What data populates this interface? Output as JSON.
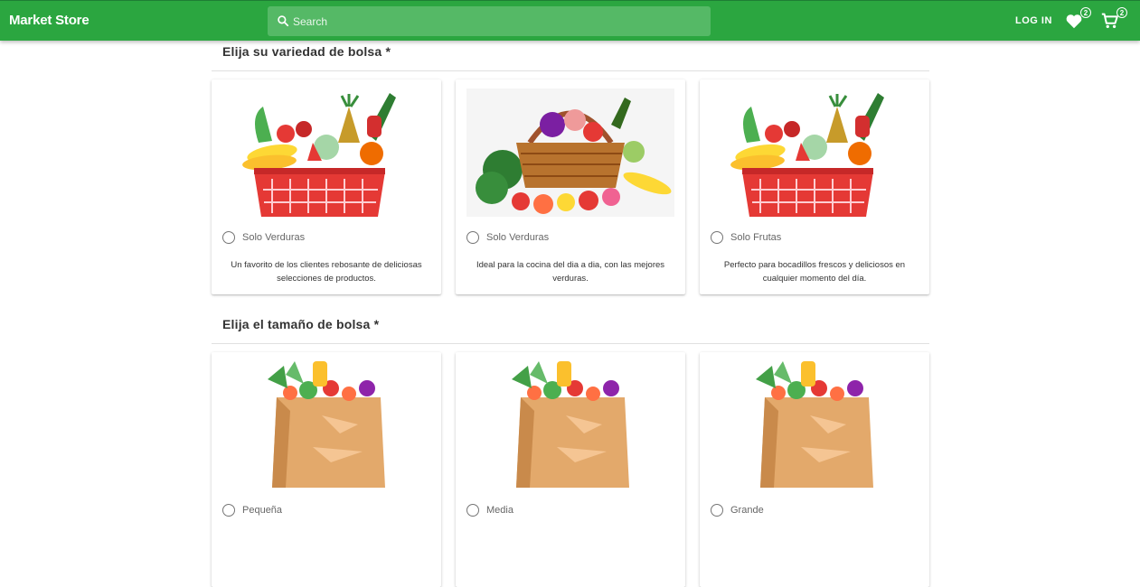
{
  "header": {
    "brand": "Market Store",
    "search_placeholder": "Search",
    "login_label": "LOG IN",
    "wishlist_count": "2",
    "cart_count": "2"
  },
  "colors": {
    "primary": "#2ba640",
    "search_bg": "#55b966"
  },
  "variety_section": {
    "title": "Elija su variedad de bolsa *",
    "options": [
      {
        "label": "Solo Verduras",
        "description": "Un favorito de los clientes rebosante de deliciosas selecciones de productos."
      },
      {
        "label": "Solo Verduras",
        "description": "Ideal para la cocina del dia a dia, con las mejores verduras."
      },
      {
        "label": "Solo Frutas",
        "description": "Perfecto para bocadillos frescos y deliciosos en cualquier momento del día."
      }
    ]
  },
  "size_section": {
    "title": "Elija el tamaño de bolsa *",
    "options": [
      {
        "label": "Pequeña"
      },
      {
        "label": "Media"
      },
      {
        "label": "Grande"
      }
    ]
  }
}
